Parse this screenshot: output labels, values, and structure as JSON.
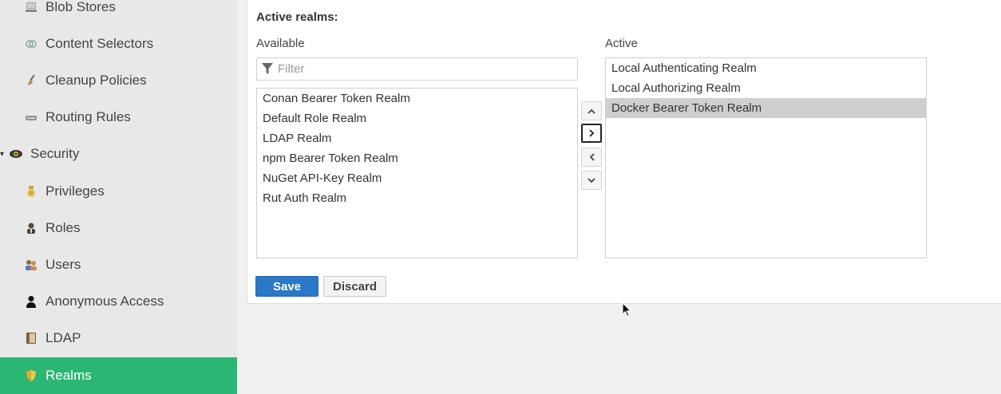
{
  "sidebar": {
    "items": [
      {
        "label": "Blob Stores",
        "icon": "server-icon"
      },
      {
        "label": "Content Selectors",
        "icon": "selector-icon"
      },
      {
        "label": "Cleanup Policies",
        "icon": "broom-icon"
      },
      {
        "label": "Routing Rules",
        "icon": "router-icon"
      },
      {
        "label": "Security",
        "icon": "eye-icon",
        "expanded": true
      },
      {
        "label": "Privileges",
        "icon": "medal-icon"
      },
      {
        "label": "Roles",
        "icon": "role-icon"
      },
      {
        "label": "Users",
        "icon": "users-icon"
      },
      {
        "label": "Anonymous Access",
        "icon": "person-icon"
      },
      {
        "label": "LDAP",
        "icon": "book-icon"
      },
      {
        "label": "Realms",
        "icon": "shield-icon",
        "active": true
      }
    ]
  },
  "realms": {
    "title": "Active realms:",
    "available_label": "Available",
    "active_label": "Active",
    "filter_placeholder": "Filter",
    "available": [
      "Conan Bearer Token Realm",
      "Default Role Realm",
      "LDAP Realm",
      "npm Bearer Token Realm",
      "NuGet API-Key Realm",
      "Rut Auth Realm"
    ],
    "active": [
      "Local Authenticating Realm",
      "Local Authorizing Realm",
      "Docker Bearer Token Realm"
    ],
    "selected_active": "Docker Bearer Token Realm",
    "save_label": "Save",
    "discard_label": "Discard"
  },
  "colors": {
    "accent_green": "#2bb673",
    "save_blue": "#2a78c7",
    "selection_gray": "#cfcfcf"
  }
}
